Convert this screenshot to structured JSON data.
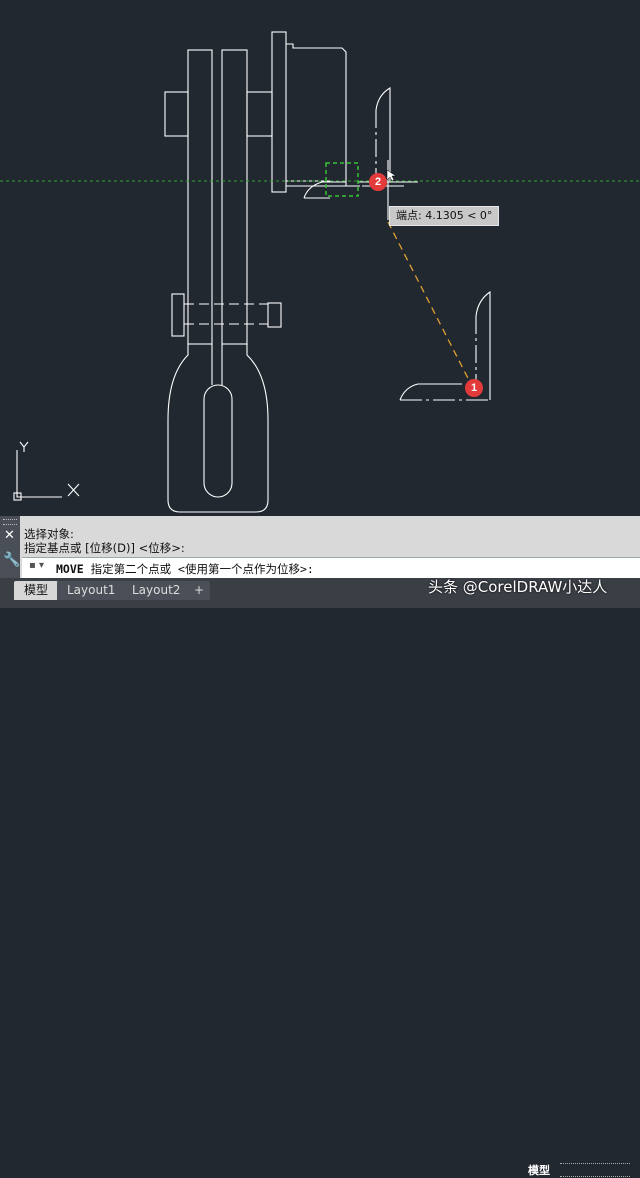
{
  "viewport": {
    "tooltip_text": "端点: 4.1305 < 0°",
    "marker_1": "1",
    "marker_2": "2",
    "ucs_y_label": "Y",
    "ucs_x_label": "X"
  },
  "command_line": {
    "history": [
      "选择对象:",
      "指定基点或 [位移(D)] <位移>:"
    ],
    "prompt_command": "MOVE",
    "prompt_text": " 指定第二个点或 <使用第一个点作为位移>:"
  },
  "tabs": [
    {
      "label": "模型",
      "active": true
    },
    {
      "label": "Layout1",
      "active": false
    },
    {
      "label": "Layout2",
      "active": false
    },
    {
      "label": "+",
      "active": false
    }
  ],
  "status": {
    "model_label": "模型"
  },
  "watermark": "头条 @CorelDRAW小达人",
  "colors": {
    "background": "#212830",
    "geometry": "#ffffff",
    "tracking_line": "#e0a030",
    "horizontal_guide": "#2fa82f",
    "marker": "#e33b3b"
  }
}
